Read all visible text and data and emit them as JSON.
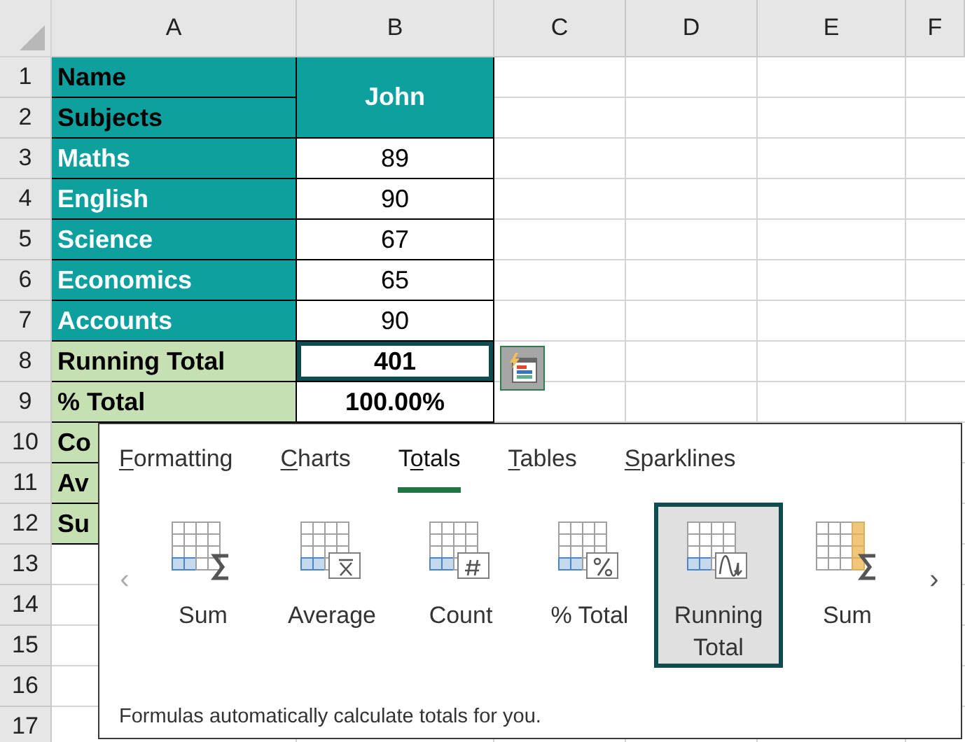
{
  "columns": [
    "A",
    "B",
    "C",
    "D",
    "E",
    "F"
  ],
  "rows": [
    {
      "number": "1",
      "a": {
        "text": "Name",
        "kind": "header",
        "selected": false
      },
      "b": {
        "text": "John",
        "kind": "header",
        "selected": false,
        "merged_down": true
      }
    },
    {
      "number": "2",
      "a": {
        "text": "Subjects",
        "kind": "header",
        "selected": false
      }
    },
    {
      "number": "3",
      "a": {
        "text": "Maths",
        "kind": "subject",
        "selected": false
      },
      "b": {
        "text": "89",
        "kind": "value",
        "selected": false
      }
    },
    {
      "number": "4",
      "a": {
        "text": "English",
        "kind": "subject",
        "selected": false
      },
      "b": {
        "text": "90",
        "kind": "value",
        "selected": false
      }
    },
    {
      "number": "5",
      "a": {
        "text": "Science",
        "kind": "subject",
        "selected": false
      },
      "b": {
        "text": "67",
        "kind": "value",
        "selected": false
      }
    },
    {
      "number": "6",
      "a": {
        "text": "Economics",
        "kind": "subject",
        "selected": false
      },
      "b": {
        "text": "65",
        "kind": "value",
        "selected": false
      }
    },
    {
      "number": "7",
      "a": {
        "text": "Accounts",
        "kind": "subject",
        "selected": false
      },
      "b": {
        "text": "90",
        "kind": "value",
        "selected": false
      }
    },
    {
      "number": "8",
      "a": {
        "text": "Running Total",
        "kind": "summary",
        "selected": false
      },
      "b": {
        "text": "401",
        "kind": "total",
        "selected": true
      }
    },
    {
      "number": "9",
      "a": {
        "text": "% Total",
        "kind": "summary",
        "selected": false
      },
      "b": {
        "text": "100.00%",
        "kind": "total",
        "selected": false
      }
    },
    {
      "number": "10",
      "a": {
        "text": "Co",
        "kind": "summary",
        "selected": false
      }
    },
    {
      "number": "11",
      "a": {
        "text": "Av",
        "kind": "summary",
        "selected": false
      }
    },
    {
      "number": "12",
      "a": {
        "text": "Su",
        "kind": "summary",
        "selected": false
      }
    },
    {
      "number": "13"
    },
    {
      "number": "14"
    },
    {
      "number": "15"
    },
    {
      "number": "16"
    },
    {
      "number": "17"
    }
  ],
  "quick_analysis": {
    "tabs": [
      {
        "access_key": "F",
        "label_after": "ormatting",
        "selected": false
      },
      {
        "access_key": "C",
        "label_after": "harts",
        "selected": false
      },
      {
        "label_before": "T",
        "access_key": "o",
        "label_after": "tals",
        "selected": true
      },
      {
        "access_key": "T",
        "label_after": "ables",
        "selected": false
      },
      {
        "access_key": "S",
        "label_after": "parklines",
        "selected": false
      }
    ],
    "scroll_left": "‹",
    "scroll_right": "›",
    "items": [
      {
        "label": "Sum",
        "kind": "sum",
        "selected": false
      },
      {
        "label": "Average",
        "kind": "average",
        "selected": false
      },
      {
        "label": "Count",
        "kind": "count",
        "selected": false
      },
      {
        "label": "% Total",
        "kind": "percent",
        "selected": false
      },
      {
        "label": "Running Total",
        "kind": "running",
        "selected": true
      },
      {
        "label": "Sum",
        "kind": "sum_column",
        "selected": false
      }
    ],
    "description": "Formulas automatically calculate totals for you."
  }
}
